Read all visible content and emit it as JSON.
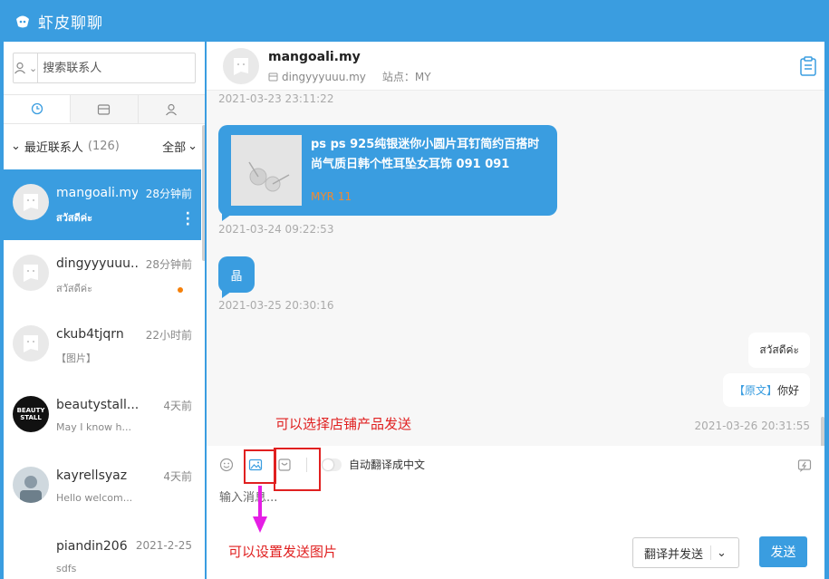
{
  "app": {
    "title": "虾皮聊聊",
    "brand_color": "#3a9de0"
  },
  "sidebar": {
    "search_placeholder": "搜索联系人",
    "recent_label": "最近联系人",
    "recent_count": "(126)",
    "filter_label": "全部",
    "tabs": [
      {
        "icon": "clock-icon"
      },
      {
        "icon": "shop-icon"
      },
      {
        "icon": "person-icon"
      }
    ],
    "contacts": [
      {
        "name": "mangoali.my",
        "time": "28分钟前",
        "preview": "สวัสดีค่ะ",
        "active": true
      },
      {
        "name": "dingyyyuuu...",
        "time": "28分钟前",
        "preview": "สวัสดีค่ะ",
        "unread": true
      },
      {
        "name": "ckub4tjqrn",
        "time": "22小时前",
        "preview": "【图片】"
      },
      {
        "name": "beautystall....",
        "time": "4天前",
        "preview": "May I know h...",
        "avatar_text": "BEAUTY STALL"
      },
      {
        "name": "kayrellsyaz",
        "time": "4天前",
        "preview": "Hello welcom..."
      },
      {
        "name": "piandin206",
        "time": "2021-2-25",
        "preview": "sdfs"
      }
    ]
  },
  "chat": {
    "contact_name": "mangoali.my",
    "handle": "dingyyyuuu.my",
    "store": "站点：MY",
    "messages": {
      "ts0": "2021-03-23 23:11:22",
      "product_title": "ps ps 925纯银迷你小圆片耳钉简约百搭时尚气质日韩个性耳坠女耳饰 091 091",
      "product_price": "MYR 11",
      "ts1": "2021-03-24 09:22:53",
      "small_text": "晶",
      "ts2": "2021-03-25 20:30:16",
      "reply1": "สวัสดีค่ะ",
      "reply2_tag": "【原文】",
      "reply2_text": "你好",
      "ts3": "2021-03-26 20:31:55"
    }
  },
  "composer": {
    "auto_translate_label": "自动翻译成中文",
    "input_placeholder": "输入消息...",
    "translate_send": "翻译并发送",
    "send": "发送"
  },
  "annotations": {
    "product_note": "可以选择店铺产品发送",
    "image_note": "可以设置发送图片",
    "color": "#e02020"
  }
}
